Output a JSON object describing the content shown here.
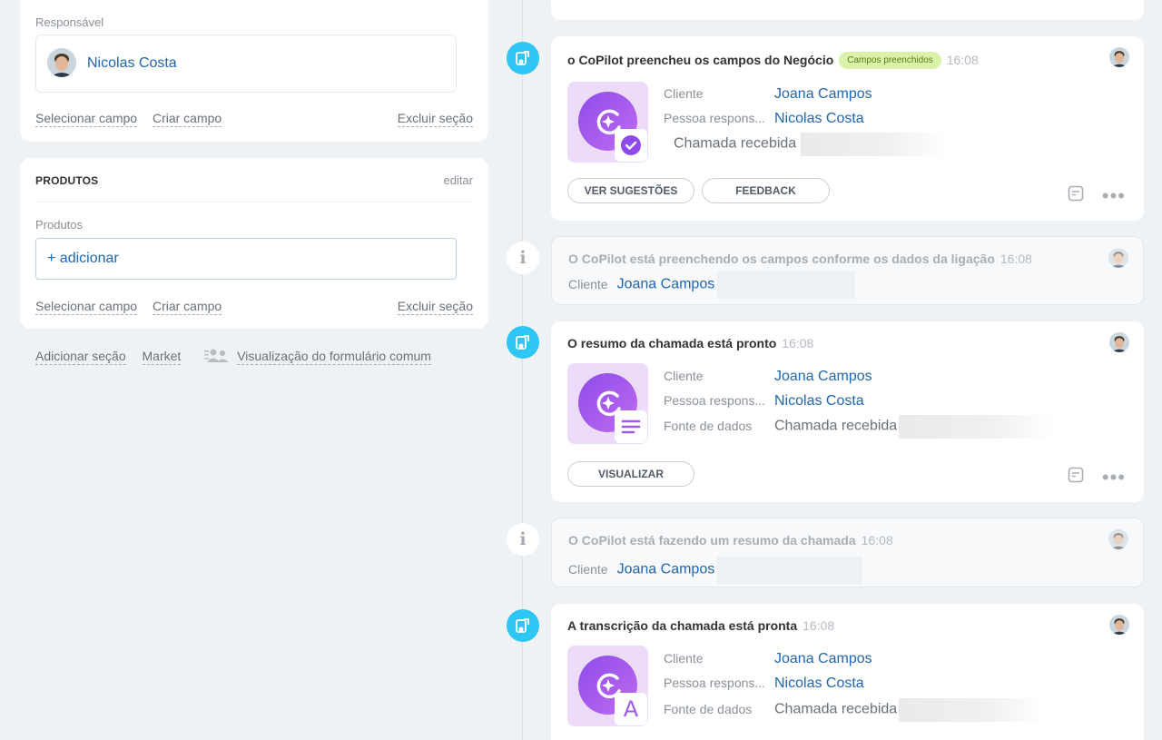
{
  "left": {
    "responsible": {
      "label": "Responsável",
      "name": "Nicolas Costa",
      "links": {
        "select": "Selecionar campo",
        "create": "Criar campo",
        "delete": "Excluir seção"
      }
    },
    "products": {
      "title": "PRODUTOS",
      "edit": "editar",
      "field_label": "Produtos",
      "add": "+ adicionar",
      "links": {
        "select": "Selecionar campo",
        "create": "Criar campo",
        "delete": "Excluir seção"
      }
    },
    "bottom": {
      "add_section": "Adicionar seção",
      "market": "Market",
      "common_form": "Visualização do formulário comum"
    }
  },
  "timeline": {
    "fields_filled": {
      "title": "o CoPilot preencheu os campos do Negócio",
      "badge": "Campos preenchidos",
      "time": "16:08",
      "rows": [
        {
          "key": "Cliente",
          "value": "Joana Campos"
        },
        {
          "key": "Pessoa respons...",
          "value": "Nicolas Costa"
        },
        {
          "key": "",
          "value": "Chamada recebida"
        }
      ],
      "buttons": {
        "suggestions": "VER SUGESTÕES",
        "feedback": "FEEDBACK"
      }
    },
    "filling": {
      "title": "O CoPilot está preenchendo os campos conforme os dados da ligação",
      "time": "16:08",
      "client_label": "Cliente",
      "client": "Joana Campos"
    },
    "summary_ready": {
      "title": "O resumo da chamada está pronto",
      "time": "16:08",
      "rows": [
        {
          "key": "Cliente",
          "value": "Joana Campos"
        },
        {
          "key": "Pessoa respons...",
          "value": "Nicolas Costa"
        },
        {
          "key": "Fonte de dados",
          "value": "Chamada recebida"
        }
      ],
      "buttons": {
        "view": "VISUALIZAR"
      }
    },
    "summarizing": {
      "title": "O CoPilot está fazendo um resumo da chamada",
      "time": "16:08",
      "client_label": "Cliente",
      "client": "Joana Campos"
    },
    "transcript_ready": {
      "title": "A transcrição da chamada está pronta",
      "time": "16:08",
      "rows": [
        {
          "key": "Cliente",
          "value": "Joana Campos"
        },
        {
          "key": "Pessoa respons...",
          "value": "Nicolas Costa"
        },
        {
          "key": "Fonte de dados",
          "value": "Chamada recebida"
        }
      ],
      "sub_icon_letter": "A"
    }
  },
  "colors": {
    "accent": "#2066b0",
    "timeline_dot": "#2fc6f6",
    "copilot": "#8e4bea",
    "badge_bg": "#d9f1a9"
  }
}
